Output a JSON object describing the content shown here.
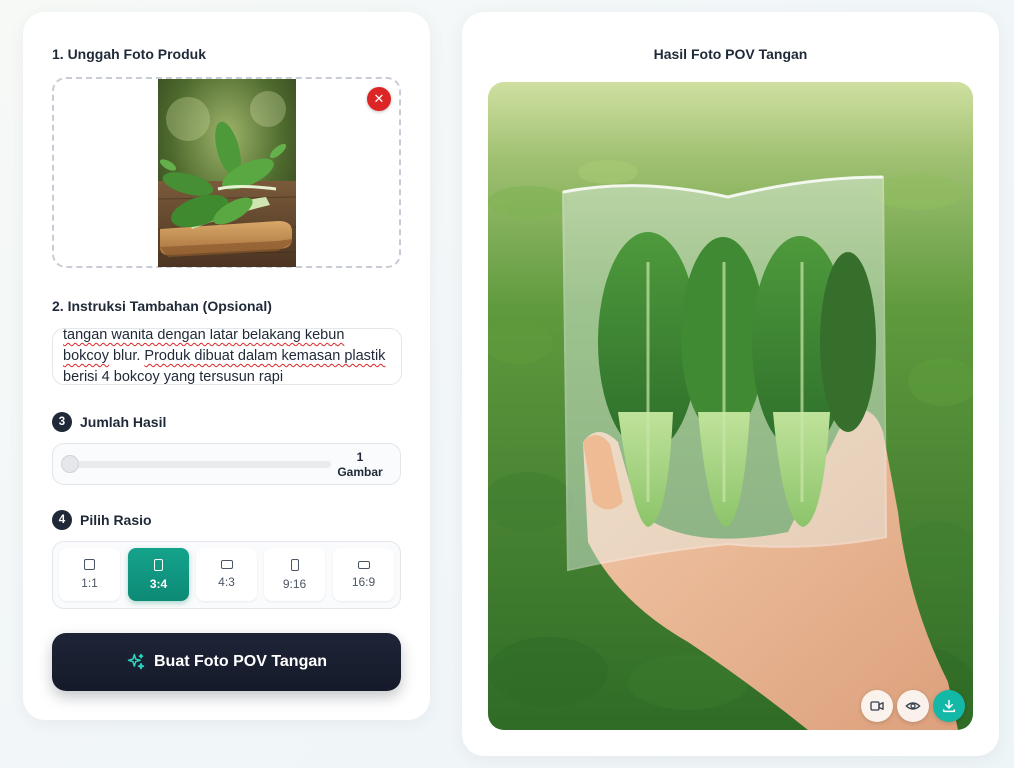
{
  "upload": {
    "heading": "1. Unggah Foto Produk",
    "remove_glyph": "✕"
  },
  "instructions": {
    "heading": "2. Instruksi Tambahan (Opsional)",
    "text_segments": [
      {
        "text": "tangan wanita dengan ",
        "error": true
      },
      {
        "text": "latar belakang kebun",
        "error": true
      },
      {
        "text": " bokcoy",
        "error": true
      },
      {
        "text": " blur. ",
        "error": false
      },
      {
        "text": "Produk dibuat dalam kemasan",
        "error": true
      },
      {
        "text": " plastik berisi",
        "error": true
      },
      {
        "text": " 4 ",
        "error": false
      },
      {
        "text": "bokcoy",
        "error": true
      },
      {
        "text": " yang ",
        "error": false
      },
      {
        "text": "tersusun rapi",
        "error": true
      }
    ]
  },
  "count": {
    "step": "3",
    "heading": "Jumlah Hasil",
    "value": "1",
    "unit": "Gambar",
    "slider_fraction": 0
  },
  "ratio": {
    "step": "4",
    "heading": "Pilih Rasio",
    "options": [
      {
        "label": "1:1",
        "active": false,
        "icon": "square-icon"
      },
      {
        "label": "3:4",
        "active": true,
        "icon": "portrait-icon"
      },
      {
        "label": "4:3",
        "active": false,
        "icon": "landscape-icon"
      },
      {
        "label": "9:16",
        "active": false,
        "icon": "tall-portrait-icon"
      },
      {
        "label": "16:9",
        "active": false,
        "icon": "wide-landscape-icon"
      }
    ]
  },
  "cta": {
    "label": "Buat Foto POV Tangan",
    "icon": "sparkles-icon"
  },
  "result": {
    "heading": "Hasil Foto POV Tangan",
    "tools": [
      "video-icon",
      "eye-icon",
      "download-icon"
    ]
  },
  "colors": {
    "accent": "#14a38c",
    "dark": "#1e2537",
    "danger": "#dc2626",
    "download": "#14b8a6"
  }
}
